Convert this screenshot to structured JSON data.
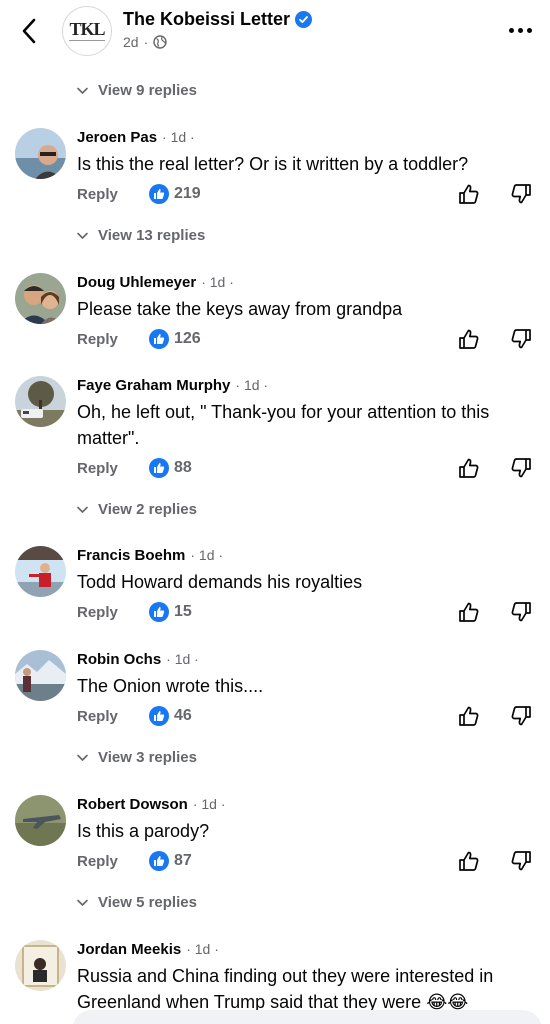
{
  "header": {
    "page_name": "The Kobeissi Letter",
    "avatar_text": "TKL",
    "age": "2d",
    "separator": "·"
  },
  "view_replies": [
    "View 9 replies",
    "View 13 replies",
    "View 2 replies",
    "View 3 replies",
    "View 5 replies"
  ],
  "comments": [
    {
      "author": "Jeroen Pas",
      "time": "· 1d ·",
      "text": "Is this the real letter? Or is it written by a toddler?",
      "reply": "Reply",
      "likes": "219"
    },
    {
      "author": "Doug Uhlemeyer",
      "time": "· 1d ·",
      "text": "Please take the keys away from grandpa",
      "reply": "Reply",
      "likes": "126"
    },
    {
      "author": "Faye Graham Murphy",
      "time": "· 1d ·",
      "text": "Oh, he left out, \" Thank-you for your attention to this matter\".",
      "reply": "Reply",
      "likes": "88"
    },
    {
      "author": "Francis Boehm",
      "time": "· 1d ·",
      "text": "Todd Howard demands his royalties",
      "reply": "Reply",
      "likes": "15"
    },
    {
      "author": "Robin Ochs",
      "time": "· 1d ·",
      "text": "The Onion wrote this....",
      "reply": "Reply",
      "likes": "46"
    },
    {
      "author": "Robert Dowson",
      "time": "· 1d ·",
      "text": "Is this a parody?",
      "reply": "Reply",
      "likes": "87"
    },
    {
      "author": "Jordan Meekis",
      "time": "· 1d ·",
      "text": "Russia and China finding out they were interested in Greenland when Trump said that they were 😂😂",
      "reply": "",
      "likes": ""
    }
  ],
  "icons": {
    "back": "chevron-left-icon",
    "more": "more-horizontal-icon",
    "verified": "verified-badge-icon",
    "privacy": "globe-icon",
    "like": "thumbs-up-icon",
    "dislike": "thumbs-down-icon",
    "expand": "chevron-down-icon"
  },
  "colors": {
    "accent": "#1877f2",
    "secondary_text": "#65676b",
    "primary_text": "#050505"
  }
}
